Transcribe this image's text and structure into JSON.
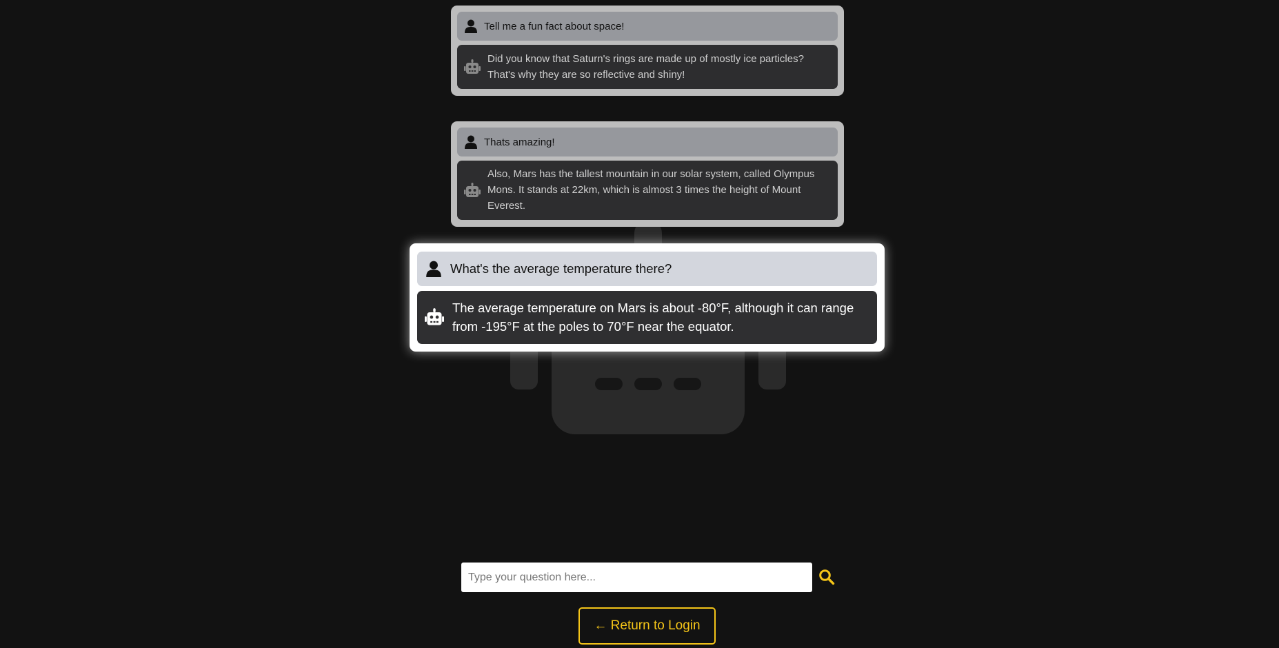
{
  "conversation": [
    {
      "user": "Tell me a fun fact about space!",
      "bot": "Did you know that Saturn's rings are made up of mostly ice particles? That's why they are so reflective and shiny!"
    },
    {
      "user": "Thats amazing!",
      "bot": "Also, Mars has the tallest mountain in our solar system, called Olympus Mons. It stands at 22km, which is almost 3 times the height of Mount Everest."
    },
    {
      "user": "What's the average temperature there?",
      "bot": "The average temperature on Mars is about -80°F, although it can range from -195°F at the poles to 70°F near the equator."
    }
  ],
  "input": {
    "placeholder": "Type your question here...",
    "value": ""
  },
  "search_icon": "search-icon",
  "return_button_label": "← Return to Login",
  "colors": {
    "background": "#121212",
    "accent": "#f5c518",
    "old_card": "#bdbdbd",
    "user_bubble_old": "#96989d",
    "user_bubble_active": "#d3d6dd",
    "bot_bubble": "#2d2d2f"
  }
}
